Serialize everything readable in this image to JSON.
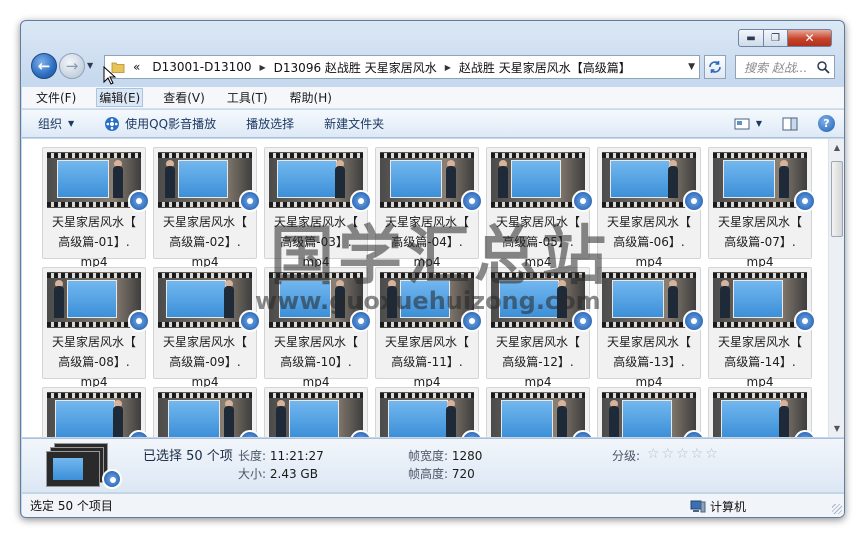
{
  "window": {
    "caption": {
      "minimize": "▬",
      "maximize": "❐",
      "close": "✕"
    }
  },
  "nav": {
    "back": "←",
    "forward": "→",
    "address": {
      "prefix": "«",
      "crumbs": [
        "D13001-D13100",
        "D13096 赵战胜 天星家居风水",
        "赵战胜 天星家居风水【高级篇】"
      ]
    },
    "search": {
      "placeholder": "搜索 赵战..."
    }
  },
  "menubar": [
    "文件(F)",
    "编辑(E)",
    "查看(V)",
    "工具(T)",
    "帮助(H)"
  ],
  "commandbar": {
    "organize": "组织",
    "play_qq": "使用QQ影音播放",
    "play_selection": "播放选择",
    "new_folder": "新建文件夹",
    "help": "?"
  },
  "files": [
    {
      "l1": "天星家居风水【",
      "l2": "高级篇-01】.",
      "l3": "mp4"
    },
    {
      "l1": "天星家居风水【",
      "l2": "高级篇-02】.",
      "l3": "mp4"
    },
    {
      "l1": "天星家居风水【",
      "l2": "高级篇-03】.",
      "l3": "mp4"
    },
    {
      "l1": "天星家居风水【",
      "l2": "高级篇-04】.",
      "l3": "mp4"
    },
    {
      "l1": "天星家居风水【",
      "l2": "高级篇-05】.",
      "l3": "mp4"
    },
    {
      "l1": "天星家居风水【",
      "l2": "高级篇-06】.",
      "l3": "mp4"
    },
    {
      "l1": "天星家居风水【",
      "l2": "高级篇-07】.",
      "l3": "mp4"
    },
    {
      "l1": "天星家居风水【",
      "l2": "高级篇-08】.",
      "l3": "mp4"
    },
    {
      "l1": "天星家居风水【",
      "l2": "高级篇-09】.",
      "l3": "mp4"
    },
    {
      "l1": "天星家居风水【",
      "l2": "高级篇-10】.",
      "l3": "mp4"
    },
    {
      "l1": "天星家居风水【",
      "l2": "高级篇-11】.",
      "l3": "mp4"
    },
    {
      "l1": "天星家居风水【",
      "l2": "高级篇-12】.",
      "l3": "mp4"
    },
    {
      "l1": "天星家居风水【",
      "l2": "高级篇-13】.",
      "l3": "mp4"
    },
    {
      "l1": "天星家居风水【",
      "l2": "高级篇-14】.",
      "l3": "mp4"
    },
    {
      "l1": "",
      "l2": "",
      "l3": ""
    },
    {
      "l1": "",
      "l2": "",
      "l3": ""
    },
    {
      "l1": "",
      "l2": "",
      "l3": ""
    },
    {
      "l1": "",
      "l2": "",
      "l3": ""
    },
    {
      "l1": "",
      "l2": "",
      "l3": ""
    },
    {
      "l1": "",
      "l2": "",
      "l3": ""
    },
    {
      "l1": "",
      "l2": "",
      "l3": ""
    }
  ],
  "details": {
    "selected": "已选择 50 个项",
    "length_label": "长度:",
    "length_value": "11:21:27",
    "size_label": "大小:",
    "size_value": "2.43 GB",
    "frame_width_label": "帧宽度:",
    "frame_width_value": "1280",
    "frame_height_label": "帧高度:",
    "frame_height_value": "720",
    "rating_label": "分级:",
    "rating_stars": "☆☆☆☆☆"
  },
  "status": {
    "left": "选定 50 个项目",
    "right": "计算机"
  },
  "watermark": {
    "cn": "国学汇总站",
    "url": "www.guoxuehuizong.com"
  },
  "colors": {
    "accent": "#2d6dc0",
    "close": "#c7442b"
  }
}
